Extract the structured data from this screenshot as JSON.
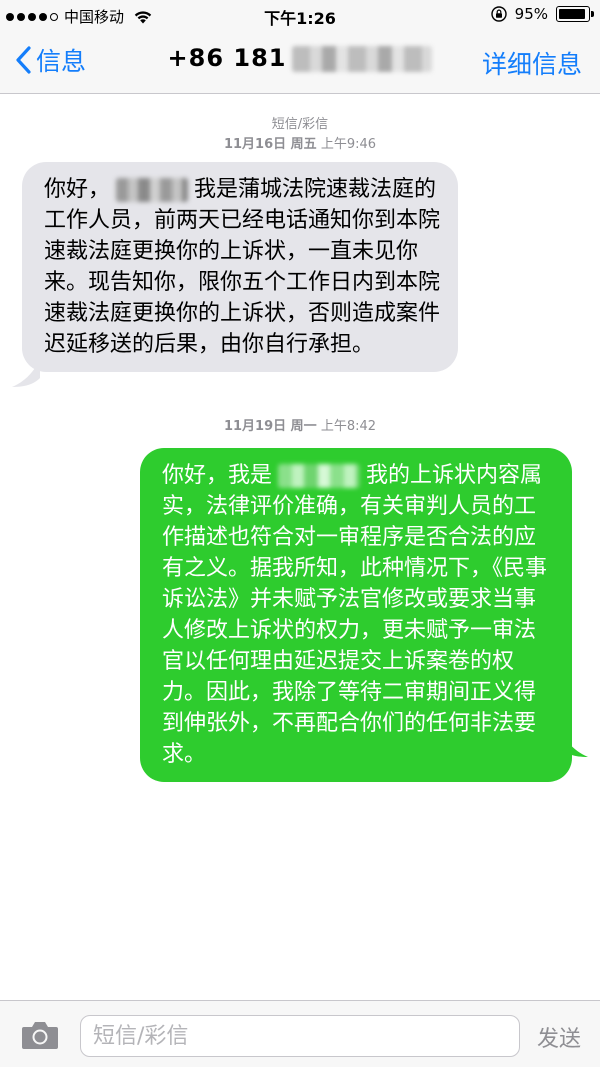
{
  "status_bar": {
    "carrier": "中国移动",
    "time": "下午1:26",
    "battery_percent": "95%",
    "battery_level": 0.95,
    "signal_bars": 4,
    "icons": [
      "wifi-icon",
      "rotation-lock-icon",
      "battery-icon"
    ]
  },
  "nav": {
    "back_label": "信息",
    "title": "+86 181",
    "detail_label": "详细信息",
    "colors": {
      "accent": "#147efb"
    }
  },
  "thread": {
    "service_label": "短信/彩信",
    "messages": [
      {
        "date_bold": "11月16日 周五",
        "date_time": "上午9:46",
        "direction": "incoming",
        "text_before_redaction": "你好，",
        "text_after_redaction": "我是蒲城法院速裁法庭的工作人员，前两天已经电话通知你到本院速裁法庭更换你的上诉状，一直未见你来。现告知你，限你五个工作日内到本院速裁法庭更换你的上诉状，否则造成案件迟延移送的后果，由你自行承担。"
      },
      {
        "date_bold": "11月19日 周一",
        "date_time": "上午8:42",
        "direction": "outgoing",
        "text_before_redaction": "你好，我是",
        "text_after_redaction": "我的上诉状内容属实，法律评价准确，有关审判人员的工作描述也符合对一审程序是否合法的应有之义。据我所知，此种情况下，《民事诉讼法》并未赋予法官修改或要求当事人修改上诉状的权力，更未赋予一审法官以任何理由延迟提交上诉案卷的权力。因此，我除了等待二审期间正义得到伸张外，不再配合你们的任何非法要求。"
      }
    ],
    "colors": {
      "incoming_bubble": "#e5e5ea",
      "outgoing_bubble": "#2ecc2e"
    }
  },
  "input_bar": {
    "placeholder": "短信/彩信",
    "value": "",
    "send_label": "发送"
  }
}
